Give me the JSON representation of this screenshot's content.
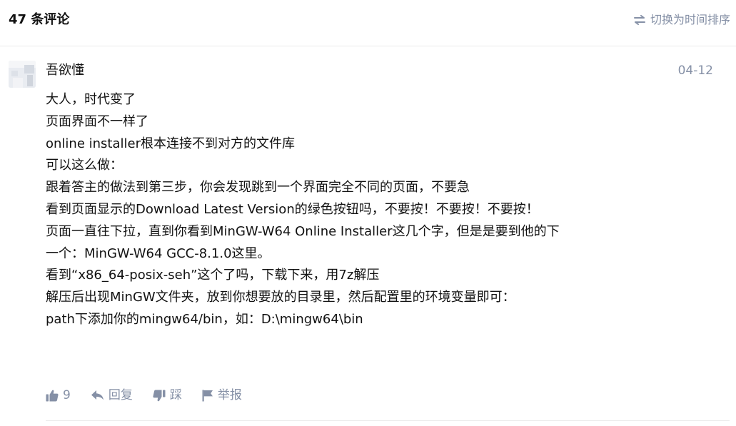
{
  "header": {
    "title": "47 条评论",
    "sort_label": "切换为时间排序",
    "sort_icon": "swap-icon"
  },
  "comment": {
    "author": "吾欲懂",
    "date": "04-12",
    "lines": [
      "大人，时代变了",
      "页面界面不一样了",
      "online installer根本连接不到对方的文件库",
      "可以这么做：",
      "跟着答主的做法到第三步，你会发现跳到一个界面完全不同的页面，不要急",
      "看到页面显示的Download Latest Version的绿色按钮吗，不要按！不要按！不要按！",
      "页面一直往下拉，直到你看到MinGW-W64 Online Installer这几个字，但是是要到他的下",
      "一个：MinGW-W64 GCC-8.1.0这里。",
      "看到“x86_64-posix-seh”这个了吗，下载下来，用7z解压",
      "解压后出现MinGW文件夹，放到你想要放的目录里，然后配置里的环境变量即可：",
      "path下添加你的mingw64/bin，如：D:\\mingw64\\bin"
    ],
    "actions": {
      "like_count": "9",
      "reply_label": "回复",
      "dislike_label": "踩",
      "report_label": "举报"
    }
  },
  "colors": {
    "muted": "#8590a6",
    "text": "#121212",
    "divider": "#ebebeb"
  }
}
